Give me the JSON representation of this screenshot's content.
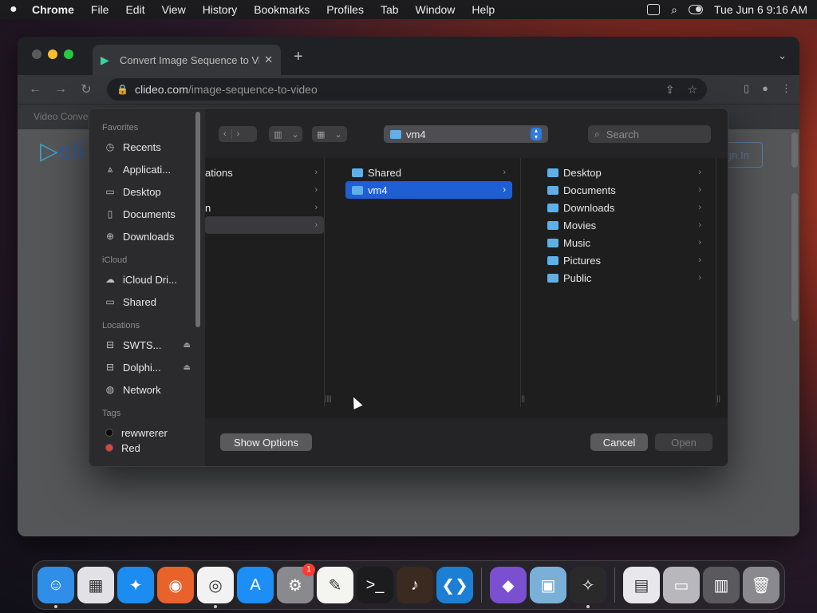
{
  "menubar": {
    "app": "Chrome",
    "items": [
      "File",
      "Edit",
      "View",
      "History",
      "Bookmarks",
      "Profiles",
      "Tab",
      "Window",
      "Help"
    ],
    "clock": "Tue Jun 6  9:16 AM"
  },
  "browser": {
    "tab_title": "Convert Image Sequence to Vi",
    "tab_close": "✕",
    "new_tab": "+",
    "url_host": "clideo.com",
    "url_path": "/image-sequence-to-video",
    "bookmark_text": "Video Conver",
    "page_logo": "cli",
    "page_signin": "gn In"
  },
  "dialog": {
    "sidebar": {
      "favorites_heading": "Favorites",
      "favorites": [
        {
          "label": "Recents",
          "icon": "clock-icon"
        },
        {
          "label": "Applicati...",
          "icon": "applications-icon"
        },
        {
          "label": "Desktop",
          "icon": "desktop-icon"
        },
        {
          "label": "Documents",
          "icon": "document-icon"
        },
        {
          "label": "Downloads",
          "icon": "download-icon"
        }
      ],
      "icloud_heading": "iCloud",
      "icloud": [
        {
          "label": "iCloud Dri...",
          "icon": "cloud-icon"
        },
        {
          "label": "Shared",
          "icon": "shared-folder-icon"
        }
      ],
      "locations_heading": "Locations",
      "locations": [
        {
          "label": "SWTS...",
          "icon": "drive-icon"
        },
        {
          "label": "Dolphi...",
          "icon": "drive-icon"
        },
        {
          "label": "Network",
          "icon": "globe-icon"
        }
      ],
      "tags_heading": "Tags",
      "tags": [
        {
          "label": "rewwrerer"
        },
        {
          "label": "Red"
        }
      ]
    },
    "path_popup": "vm4",
    "search_placeholder": "Search",
    "column_a": [
      "ations",
      "",
      "n",
      ""
    ],
    "column_b": [
      "Shared",
      "vm4"
    ],
    "column_c": [
      "Desktop",
      "Documents",
      "Downloads",
      "Movies",
      "Music",
      "Pictures",
      "Public"
    ],
    "show_options": "Show Options",
    "cancel": "Cancel",
    "open": "Open"
  },
  "dock": {
    "apps": [
      {
        "name": "finder-icon",
        "glyph": "☺",
        "color": "#2f8fe8",
        "running": true
      },
      {
        "name": "launchpad-icon",
        "glyph": "▦",
        "color": "#e2e2e6",
        "running": false
      },
      {
        "name": "safari-icon",
        "glyph": "✦",
        "color": "#1c8cf0",
        "running": false
      },
      {
        "name": "firefox-icon",
        "glyph": "◉",
        "color": "#e8622c",
        "running": false
      },
      {
        "name": "chrome-icon",
        "glyph": "◎",
        "color": "#f2f2f2",
        "running": true
      },
      {
        "name": "app-store-icon",
        "glyph": "A",
        "color": "#1c8ef5",
        "running": false
      },
      {
        "name": "system-settings-icon",
        "glyph": "⚙",
        "color": "#8a8a8e",
        "running": false,
        "badge": "1"
      },
      {
        "name": "textedit-icon",
        "glyph": "✎",
        "color": "#f4f4f0",
        "running": false
      },
      {
        "name": "terminal-icon",
        "glyph": ">_",
        "color": "#1c1c1e",
        "running": false
      },
      {
        "name": "instruments-icon",
        "glyph": "♪",
        "color": "#3a2a20",
        "running": false
      },
      {
        "name": "vscode-icon",
        "glyph": "❮❯",
        "color": "#1c7fd4",
        "running": false
      }
    ],
    "recents": [
      {
        "name": "visual-studio-icon",
        "glyph": "◆",
        "color": "#7a4fd0",
        "running": false
      },
      {
        "name": "preview-icon",
        "glyph": "▣",
        "color": "#7ab0d8",
        "running": false
      },
      {
        "name": "xcode-sim-icon",
        "glyph": "✧",
        "color": "#2a2a2a",
        "running": true
      }
    ],
    "stacks": [
      {
        "name": "downloads-stack-icon",
        "glyph": "▤",
        "color": "#e8e8ec"
      },
      {
        "name": "documents-stack-icon",
        "glyph": "▭",
        "color": "#b8b8bc"
      },
      {
        "name": "screenshots-stack-icon",
        "glyph": "▥",
        "color": "#5a5a5e"
      },
      {
        "name": "trash-icon",
        "glyph": "🗑",
        "color": "#8a8a8e"
      }
    ]
  }
}
